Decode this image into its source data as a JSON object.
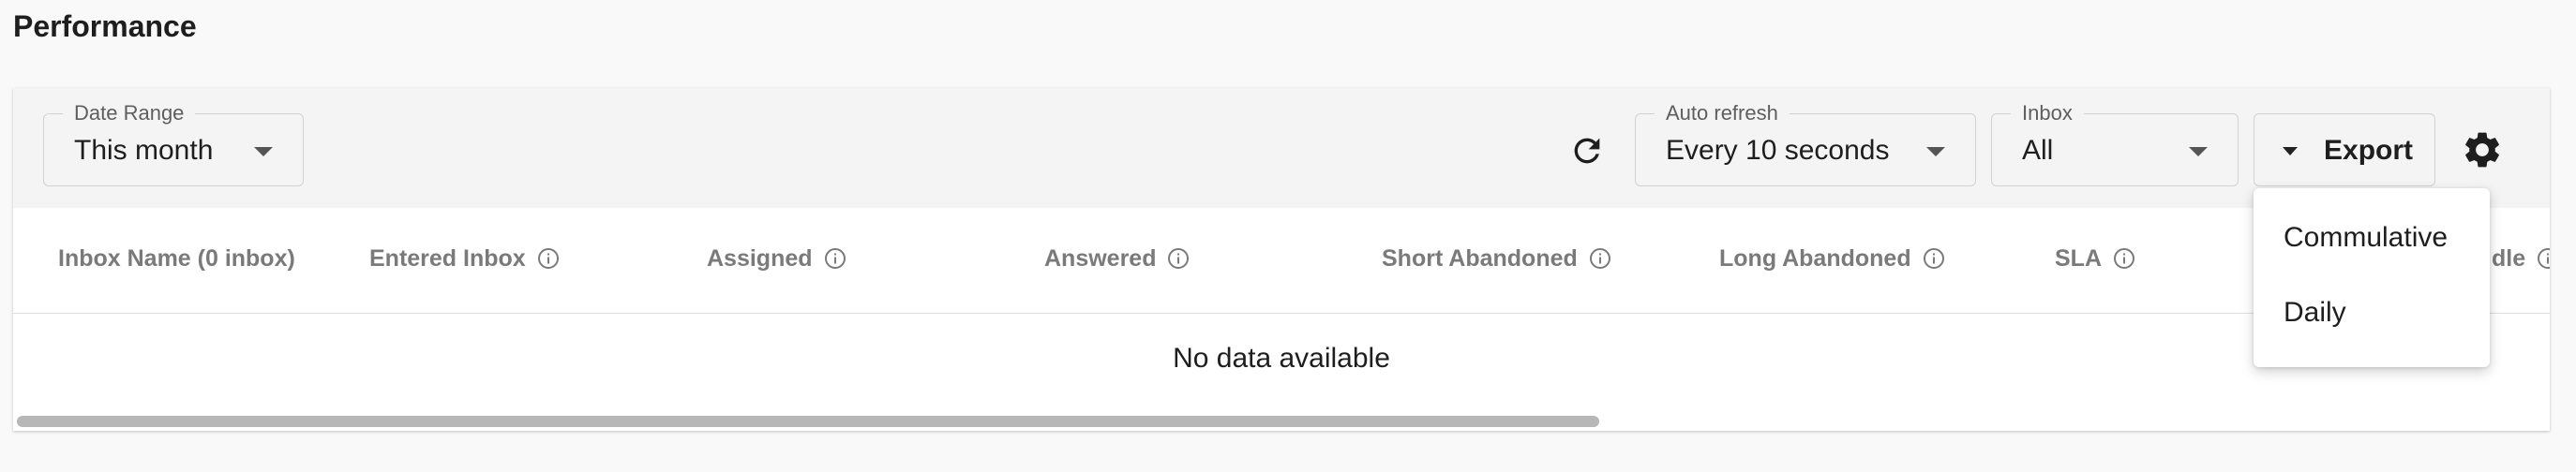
{
  "page": {
    "title": "Performance"
  },
  "toolbar": {
    "date_range": {
      "label": "Date Range",
      "value": "This month"
    },
    "refresh_icon": "refresh-icon",
    "auto_refresh": {
      "label": "Auto refresh",
      "value": "Every 10 seconds"
    },
    "inbox": {
      "label": "Inbox",
      "value": "All"
    },
    "export": {
      "label": "Export"
    },
    "settings_icon": "gear-icon"
  },
  "table": {
    "columns": [
      {
        "label": "Inbox Name (0 inbox)",
        "info": false
      },
      {
        "label": "Entered Inbox",
        "info": true
      },
      {
        "label": "Assigned",
        "info": true
      },
      {
        "label": "Answered",
        "info": true
      },
      {
        "label": "Short Abandoned",
        "info": true
      },
      {
        "label": "Long Abandoned",
        "info": true
      },
      {
        "label": "SLA",
        "info": true
      },
      {
        "label": "dle",
        "info": true
      }
    ],
    "empty_message": "No data available"
  },
  "export_menu": {
    "items": [
      "Commulative",
      "Daily"
    ]
  },
  "colors": {
    "background": "#f9f9f9",
    "toolbar": "#f4f4f4",
    "header_text": "#7a7a7a",
    "text": "#1e1e1e"
  }
}
